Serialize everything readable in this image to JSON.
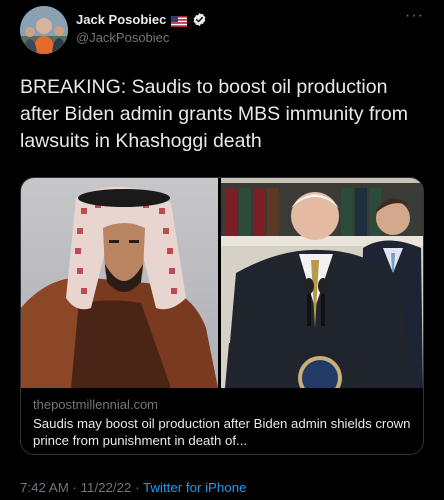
{
  "author": {
    "display_name": "Jack Posobiec",
    "handle": "@JackPosobiec"
  },
  "icons": {
    "flag": "us-flag-icon",
    "verified": "verified-badge-icon",
    "more": "more-options-icon"
  },
  "more_label": "···",
  "tweet": {
    "text": "BREAKING: Saudis to boost oil production after Biden admin grants MBS immunity from lawsuits in Khashoggi death"
  },
  "card": {
    "domain": "thepostmillennial.com",
    "title": "Saudis may boost oil production after Biden admin shields crown prince from punishment in death of..."
  },
  "meta": {
    "time": "7:42 AM",
    "separator": "·",
    "date": "11/22/22",
    "source": "Twitter for iPhone"
  },
  "colors": {
    "background": "#000000",
    "text": "#e7e9ea",
    "secondary": "#71767b",
    "link": "#1d9bf0",
    "border": "#2f3336"
  }
}
